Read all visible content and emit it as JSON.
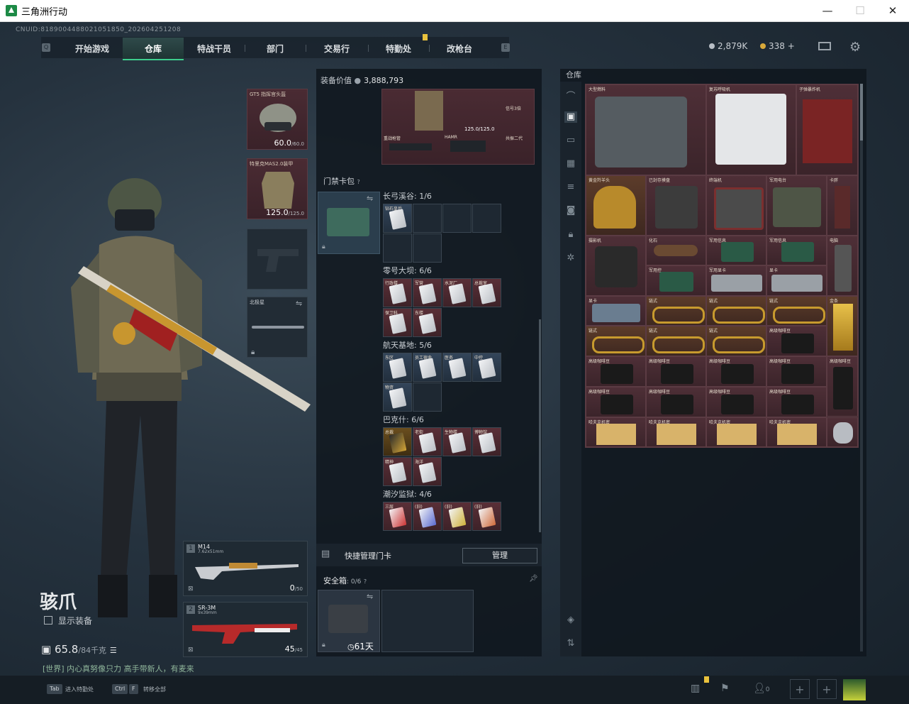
{
  "window": {
    "title": "三角洲行动",
    "minimize": "—",
    "maximize": "☐",
    "close": "✕"
  },
  "uid": "CNUID:8189004488021051850_202604251208",
  "nav": {
    "tabs": [
      "开始游戏",
      "仓库",
      "特战干员",
      "部门",
      "交易行",
      "特勤处",
      "改枪台"
    ],
    "active_index": 1
  },
  "currency": {
    "coins": "2,879K",
    "tickets": "338",
    "tickets_add": "+"
  },
  "character": {
    "name": "骇爪",
    "show_equip_label": "显示装备",
    "weight": "65.8",
    "weight_max": "/84千克",
    "chat_channel": "[世界]",
    "chat_text": "[世界] 内心真努像只力 高手带新人，有麦来"
  },
  "equipment": {
    "helmet": {
      "name": "GT5 指挥官头盔",
      "value": "60.0",
      "max": "/60.0"
    },
    "armor": {
      "name": "特里克MAS2.0装甲",
      "value": "125.0",
      "max": "/125.0"
    },
    "pistol": {
      "name": ""
    },
    "melee": {
      "name": "北极星"
    }
  },
  "weapons": [
    {
      "slot": "1",
      "name": "M14",
      "caliber": "7.62x51mm",
      "ammo": "0",
      "ammo_max": "/50"
    },
    {
      "slot": "2",
      "name": "SR-3M",
      "caliber": "9x39mm",
      "ammo": "45",
      "ammo_max": "/45"
    }
  ],
  "middle": {
    "equip_value_label": "装备价值",
    "equip_value": "3,888,793",
    "top_items": [
      {
        "name": "",
        "value": "125.0/125.0"
      },
      {
        "name": "战术手电"
      },
      {
        "name": "信号3倍"
      },
      {
        "name": "重战枪管"
      },
      {
        "name": "HAMR"
      },
      {
        "name": "共振二代"
      }
    ],
    "keycard_pack_label": "门禁卡包",
    "maps": [
      {
        "name": "长弓溪谷: 1/6",
        "cards": [
          "钻石皇后"
        ],
        "style": "blue"
      },
      {
        "name": "零号大坝: 6/6",
        "cards": [
          "行政楼",
          "军营",
          "水泥厂",
          "总裁室",
          "保卫科",
          "东楼"
        ],
        "style": "red"
      },
      {
        "name": "航天基地: 5/6",
        "cards": [
          "东区",
          "员工宿舍",
          "医务",
          "中控",
          "物资"
        ],
        "style": "blue"
      },
      {
        "name": "巴克什: 6/6",
        "cards": [
          "总裁",
          "老街",
          "生物楼",
          "博物馆",
          "精神",
          "海洋"
        ],
        "style": "red"
      },
      {
        "name": "潮汐监狱: 4/6",
        "cards": [
          "三层",
          "(旧)",
          "(旧)",
          "(旧)"
        ],
        "style": "red"
      }
    ],
    "quick_manage_label": "快捷管理门卡",
    "manage_button": "管理",
    "safebox_label": "安全箱",
    "safebox_count": ": 0/6",
    "safebox_days": "61天"
  },
  "warehouse": {
    "title": "仓库",
    "items": [
      {
        "name": "大型燃料"
      },
      {
        "name": "复苏呼吸机"
      },
      {
        "name": "子弹暴炸机"
      },
      {
        "name": "黄金羚羊头"
      },
      {
        "name": "已封存摸盘"
      },
      {
        "name": "终端机"
      },
      {
        "name": "军用电台"
      },
      {
        "name": "卡胖"
      },
      {
        "name": "摄影机"
      },
      {
        "name": "化石"
      },
      {
        "name": "军用信息"
      },
      {
        "name": "军用信息"
      },
      {
        "name": "军用控"
      },
      {
        "name": "军用显卡"
      },
      {
        "name": "显卡"
      },
      {
        "name": "显卡"
      },
      {
        "name": "电脑"
      },
      {
        "name": "链式"
      },
      {
        "name": "链式"
      },
      {
        "name": "链式"
      },
      {
        "name": "金条"
      },
      {
        "name": "链式"
      },
      {
        "name": "链式"
      },
      {
        "name": "链式"
      },
      {
        "name": "高级咖啡豆"
      },
      {
        "name": "高级咖啡豆"
      },
      {
        "name": "高级咖啡豆"
      },
      {
        "name": "高级咖啡豆"
      },
      {
        "name": "高级咖啡豆"
      },
      {
        "name": "高级咖啡豆"
      },
      {
        "name": "高级咖啡豆"
      },
      {
        "name": "高级咖啡豆"
      },
      {
        "name": "高级咖啡豆"
      },
      {
        "name": "高级咖啡豆"
      },
      {
        "name": "哈夫克机密"
      },
      {
        "name": "哈夫克机密"
      },
      {
        "name": "哈夫克机密"
      },
      {
        "name": "哈夫克机密"
      },
      {
        "name": "哈夫克机密"
      },
      {
        "name": ""
      }
    ]
  },
  "bottom": {
    "tab_key": "Tab",
    "tab_label": "进入特勤处",
    "ctrl_key": "Ctrl",
    "f_key": "F",
    "transfer_label": "转移全部",
    "friends_count": "0"
  }
}
